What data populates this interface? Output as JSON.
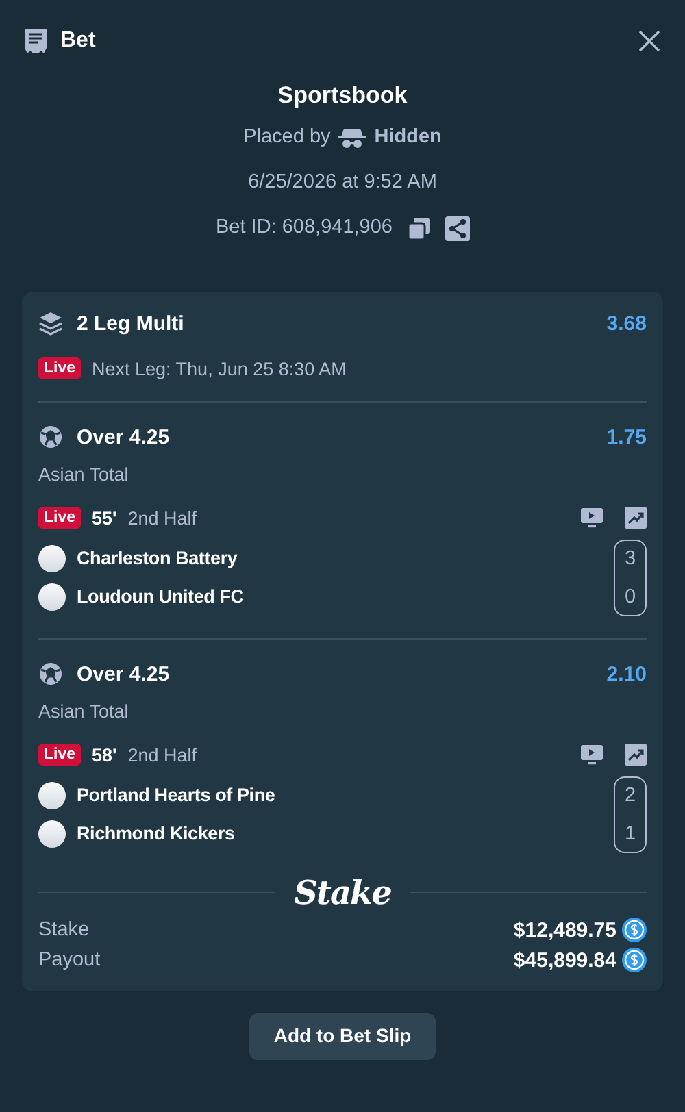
{
  "header": {
    "title": "Bet"
  },
  "summary": {
    "title": "Sportsbook",
    "placed_by_label": "Placed by",
    "placed_by_user": "Hidden",
    "date": "6/25/2026 at 9:52 AM",
    "bet_id": "Bet ID: 608,941,906"
  },
  "multi": {
    "title": "2 Leg Multi",
    "odds": "3.68",
    "badge": "Live",
    "next_leg": "Next Leg: Thu, Jun 25 8:30 AM"
  },
  "legs": [
    {
      "title": "Over 4.25",
      "odds": "1.75",
      "market": "Asian Total",
      "badge": "Live",
      "minute": "55'",
      "period": "2nd Half",
      "teams": [
        {
          "name": "Charleston Battery",
          "score": "3"
        },
        {
          "name": "Loudoun United FC",
          "score": "0"
        }
      ]
    },
    {
      "title": "Over 4.25",
      "odds": "2.10",
      "market": "Asian Total",
      "badge": "Live",
      "minute": "58'",
      "period": "2nd Half",
      "teams": [
        {
          "name": "Portland Hearts of Pine",
          "score": "2"
        },
        {
          "name": "Richmond Kickers",
          "score": "1"
        }
      ]
    }
  ],
  "logo": "Stake",
  "totals": [
    {
      "label": "Stake",
      "amount": "$12,489.75"
    },
    {
      "label": "Payout",
      "amount": "$45,899.84"
    }
  ],
  "button": "Add to Bet Slip"
}
